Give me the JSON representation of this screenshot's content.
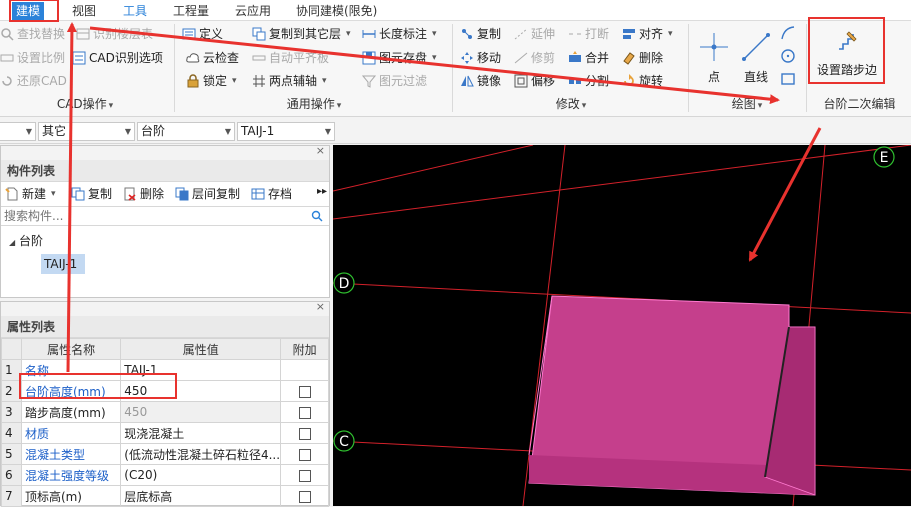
{
  "menubar": {
    "items": [
      "建模",
      "视图",
      "工具",
      "工程量",
      "云应用",
      "协同建模(限免)"
    ]
  },
  "ribbon": {
    "cad_group": {
      "label": "CAD操作",
      "items": [
        "查找替换",
        "识别楼层表",
        "设置比例",
        "CAD识别选项",
        "还原CAD"
      ]
    },
    "general_group": {
      "label": "通用操作",
      "items": [
        "定义",
        "复制到其它层",
        "长度标注",
        "云检查",
        "自动平齐板",
        "图元存盘",
        "锁定",
        "两点辅轴",
        "图元过滤"
      ]
    },
    "modify_group": {
      "label": "修改",
      "items": [
        "复制",
        "延伸",
        "打断",
        "对齐",
        "移动",
        "修剪",
        "合并",
        "删除",
        "镜像",
        "偏移",
        "分割",
        "旋转"
      ]
    },
    "draw_group": {
      "label": "绘图",
      "items": [
        "点",
        "直线"
      ]
    },
    "step_group": {
      "label": "台阶二次编辑",
      "button": "设置踏步边"
    }
  },
  "combobar": {
    "combos": [
      "",
      "其它",
      "台阶",
      "TAIJ-1"
    ]
  },
  "component_list": {
    "title": "构件列表",
    "tools": [
      "新建",
      "复制",
      "删除",
      "层间复制",
      "存档"
    ],
    "search_placeholder": "搜索构件...",
    "tree_root": "台阶",
    "tree_child": "TAIJ-1"
  },
  "property_list": {
    "title": "属性列表",
    "headers": [
      "",
      "属性名称",
      "属性值",
      "附加"
    ],
    "rows": [
      {
        "num": "1",
        "name": "名称",
        "value": "TAIJ-1",
        "blue": true,
        "gray": false,
        "check": false
      },
      {
        "num": "2",
        "name": "台阶高度(mm)",
        "value": "450",
        "blue": true,
        "gray": false,
        "check": true
      },
      {
        "num": "3",
        "name": "踏步高度(mm)",
        "value": "450",
        "blue": false,
        "gray": true,
        "check": true
      },
      {
        "num": "4",
        "name": "材质",
        "value": "现浇混凝土",
        "blue": true,
        "gray": false,
        "check": true
      },
      {
        "num": "5",
        "name": "混凝土类型",
        "value": "(低流动性混凝土碎石粒径4...",
        "blue": true,
        "gray": false,
        "check": true
      },
      {
        "num": "6",
        "name": "混凝土强度等级",
        "value": "(C20)",
        "blue": true,
        "gray": false,
        "check": true
      },
      {
        "num": "7",
        "name": "顶标高(m)",
        "value": "层底标高",
        "blue": false,
        "gray": false,
        "check": true
      }
    ]
  },
  "viewport": {
    "axis_labels": [
      "E",
      "D",
      "C"
    ]
  },
  "colors": {
    "accent": "#2b82d9",
    "highlight_red": "#e8322e",
    "step_fill": "#c53f8c"
  }
}
